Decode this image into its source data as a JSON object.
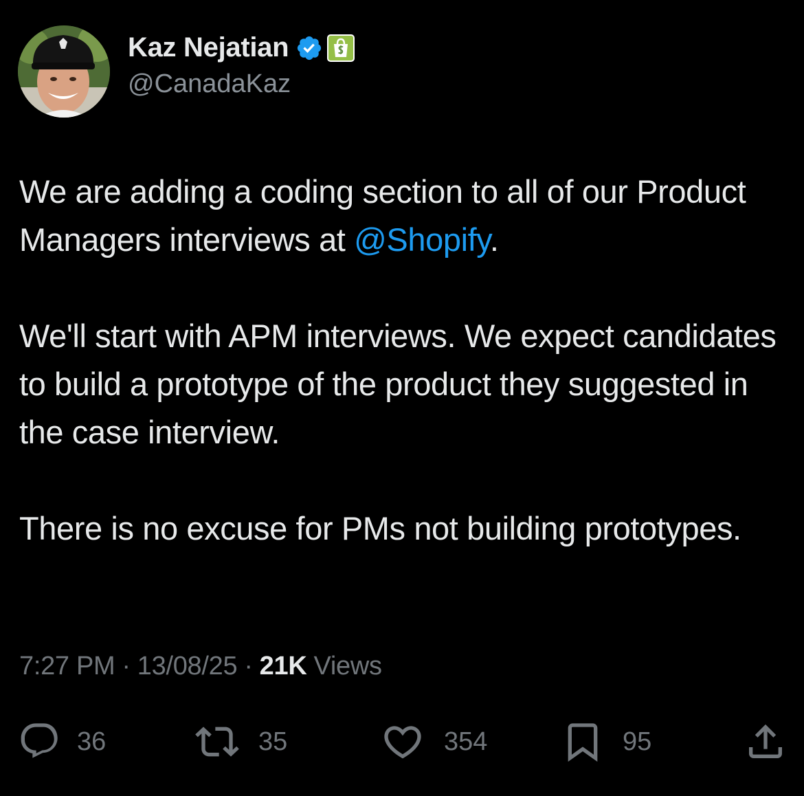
{
  "author": {
    "display_name": "Kaz Nejatian",
    "handle": "@CanadaKaz",
    "verified_icon": "verified-badge-icon",
    "affiliate_icon": "shopify-bag-icon"
  },
  "tweet": {
    "p1_before": "We are adding a coding section to all of our Product Managers interviews at ",
    "p1_mention": "@Shopify",
    "p1_after": ".",
    "p2": "We'll start with APM interviews. We expect candidates to build a prototype of the product they suggested in the case interview.",
    "p3": "There is no excuse for PMs not building prototypes."
  },
  "meta": {
    "time": "7:27 PM",
    "separator": "·",
    "date": "13/08/25",
    "views_count": "21K",
    "views_label": "Views"
  },
  "actions": {
    "replies": "36",
    "reposts": "35",
    "likes": "354",
    "bookmarks": "95"
  },
  "colors": {
    "background": "#000000",
    "text": "#e7e9ea",
    "muted": "#71767b",
    "link": "#1d9bf0",
    "verified": "#1d9bf0",
    "shopify_green": "#95bf47"
  }
}
